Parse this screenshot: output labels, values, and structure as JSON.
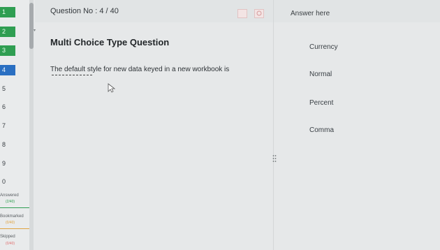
{
  "question_nav": {
    "items": [
      {
        "label": "1",
        "state": "answered"
      },
      {
        "label": "2",
        "state": "answered"
      },
      {
        "label": "3",
        "state": "answered"
      },
      {
        "label": "4",
        "state": "current"
      },
      {
        "label": "5",
        "state": "plain"
      },
      {
        "label": "6",
        "state": "plain"
      },
      {
        "label": "7",
        "state": "plain"
      },
      {
        "label": "8",
        "state": "plain"
      },
      {
        "label": "9",
        "state": "plain"
      },
      {
        "label": "0",
        "state": "plain"
      }
    ],
    "legend": [
      {
        "label": "Answered",
        "count": "(2/40)",
        "color": "#2f9e52"
      },
      {
        "label": "Bookmarked",
        "count": "(0/40)",
        "color": "#e0a340"
      },
      {
        "label": "Skipped",
        "count": "(0/40)",
        "color": "#e07070"
      }
    ]
  },
  "header": {
    "question_no": "Question No : 4 / 40",
    "answer_here": "Answer here"
  },
  "question": {
    "type": "Multi Choice Type Question",
    "text": "The default style for new data keyed in a new workbook is"
  },
  "options": [
    {
      "label": "Currency"
    },
    {
      "label": "Normal"
    },
    {
      "label": "Percent"
    },
    {
      "label": "Comma"
    }
  ],
  "colors": {
    "answered": "#2f9e52",
    "current": "#2a6fc2",
    "flag": "#e2c3c3"
  }
}
